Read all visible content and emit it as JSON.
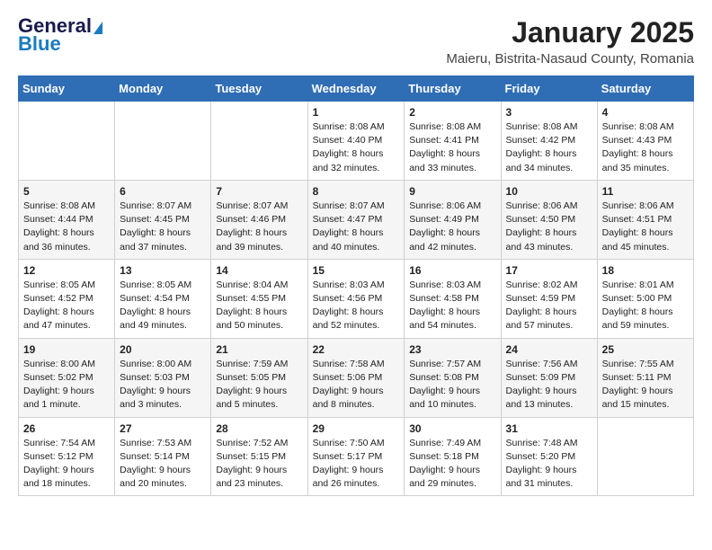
{
  "header": {
    "logo_general": "General",
    "logo_blue": "Blue",
    "month_year": "January 2025",
    "location": "Maieru, Bistrita-Nasaud County, Romania"
  },
  "weekdays": [
    "Sunday",
    "Monday",
    "Tuesday",
    "Wednesday",
    "Thursday",
    "Friday",
    "Saturday"
  ],
  "weeks": [
    [
      {
        "day": "",
        "info": ""
      },
      {
        "day": "",
        "info": ""
      },
      {
        "day": "",
        "info": ""
      },
      {
        "day": "1",
        "info": "Sunrise: 8:08 AM\nSunset: 4:40 PM\nDaylight: 8 hours and 32 minutes."
      },
      {
        "day": "2",
        "info": "Sunrise: 8:08 AM\nSunset: 4:41 PM\nDaylight: 8 hours and 33 minutes."
      },
      {
        "day": "3",
        "info": "Sunrise: 8:08 AM\nSunset: 4:42 PM\nDaylight: 8 hours and 34 minutes."
      },
      {
        "day": "4",
        "info": "Sunrise: 8:08 AM\nSunset: 4:43 PM\nDaylight: 8 hours and 35 minutes."
      }
    ],
    [
      {
        "day": "5",
        "info": "Sunrise: 8:08 AM\nSunset: 4:44 PM\nDaylight: 8 hours and 36 minutes."
      },
      {
        "day": "6",
        "info": "Sunrise: 8:07 AM\nSunset: 4:45 PM\nDaylight: 8 hours and 37 minutes."
      },
      {
        "day": "7",
        "info": "Sunrise: 8:07 AM\nSunset: 4:46 PM\nDaylight: 8 hours and 39 minutes."
      },
      {
        "day": "8",
        "info": "Sunrise: 8:07 AM\nSunset: 4:47 PM\nDaylight: 8 hours and 40 minutes."
      },
      {
        "day": "9",
        "info": "Sunrise: 8:06 AM\nSunset: 4:49 PM\nDaylight: 8 hours and 42 minutes."
      },
      {
        "day": "10",
        "info": "Sunrise: 8:06 AM\nSunset: 4:50 PM\nDaylight: 8 hours and 43 minutes."
      },
      {
        "day": "11",
        "info": "Sunrise: 8:06 AM\nSunset: 4:51 PM\nDaylight: 8 hours and 45 minutes."
      }
    ],
    [
      {
        "day": "12",
        "info": "Sunrise: 8:05 AM\nSunset: 4:52 PM\nDaylight: 8 hours and 47 minutes."
      },
      {
        "day": "13",
        "info": "Sunrise: 8:05 AM\nSunset: 4:54 PM\nDaylight: 8 hours and 49 minutes."
      },
      {
        "day": "14",
        "info": "Sunrise: 8:04 AM\nSunset: 4:55 PM\nDaylight: 8 hours and 50 minutes."
      },
      {
        "day": "15",
        "info": "Sunrise: 8:03 AM\nSunset: 4:56 PM\nDaylight: 8 hours and 52 minutes."
      },
      {
        "day": "16",
        "info": "Sunrise: 8:03 AM\nSunset: 4:58 PM\nDaylight: 8 hours and 54 minutes."
      },
      {
        "day": "17",
        "info": "Sunrise: 8:02 AM\nSunset: 4:59 PM\nDaylight: 8 hours and 57 minutes."
      },
      {
        "day": "18",
        "info": "Sunrise: 8:01 AM\nSunset: 5:00 PM\nDaylight: 8 hours and 59 minutes."
      }
    ],
    [
      {
        "day": "19",
        "info": "Sunrise: 8:00 AM\nSunset: 5:02 PM\nDaylight: 9 hours and 1 minute."
      },
      {
        "day": "20",
        "info": "Sunrise: 8:00 AM\nSunset: 5:03 PM\nDaylight: 9 hours and 3 minutes."
      },
      {
        "day": "21",
        "info": "Sunrise: 7:59 AM\nSunset: 5:05 PM\nDaylight: 9 hours and 5 minutes."
      },
      {
        "day": "22",
        "info": "Sunrise: 7:58 AM\nSunset: 5:06 PM\nDaylight: 9 hours and 8 minutes."
      },
      {
        "day": "23",
        "info": "Sunrise: 7:57 AM\nSunset: 5:08 PM\nDaylight: 9 hours and 10 minutes."
      },
      {
        "day": "24",
        "info": "Sunrise: 7:56 AM\nSunset: 5:09 PM\nDaylight: 9 hours and 13 minutes."
      },
      {
        "day": "25",
        "info": "Sunrise: 7:55 AM\nSunset: 5:11 PM\nDaylight: 9 hours and 15 minutes."
      }
    ],
    [
      {
        "day": "26",
        "info": "Sunrise: 7:54 AM\nSunset: 5:12 PM\nDaylight: 9 hours and 18 minutes."
      },
      {
        "day": "27",
        "info": "Sunrise: 7:53 AM\nSunset: 5:14 PM\nDaylight: 9 hours and 20 minutes."
      },
      {
        "day": "28",
        "info": "Sunrise: 7:52 AM\nSunset: 5:15 PM\nDaylight: 9 hours and 23 minutes."
      },
      {
        "day": "29",
        "info": "Sunrise: 7:50 AM\nSunset: 5:17 PM\nDaylight: 9 hours and 26 minutes."
      },
      {
        "day": "30",
        "info": "Sunrise: 7:49 AM\nSunset: 5:18 PM\nDaylight: 9 hours and 29 minutes."
      },
      {
        "day": "31",
        "info": "Sunrise: 7:48 AM\nSunset: 5:20 PM\nDaylight: 9 hours and 31 minutes."
      },
      {
        "day": "",
        "info": ""
      }
    ]
  ]
}
